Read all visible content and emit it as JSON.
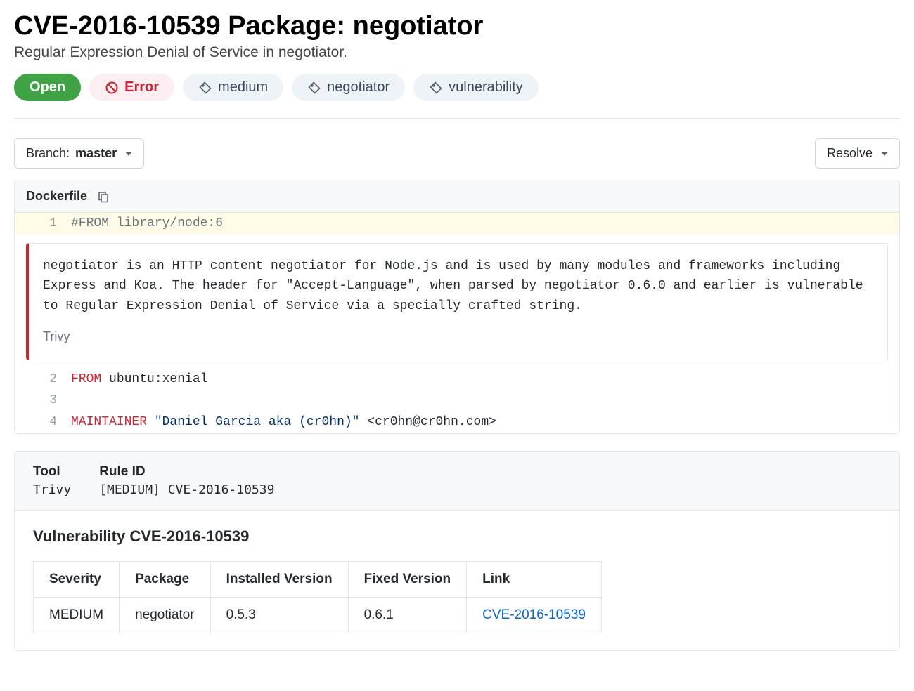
{
  "header": {
    "title": "CVE-2016-10539 Package: negotiator",
    "subtitle": "Regular Expression Denial of Service in negotiator."
  },
  "status": {
    "open_label": "Open",
    "error_label": "Error"
  },
  "tags": [
    "medium",
    "negotiator",
    "vulnerability"
  ],
  "toolbar": {
    "branch_label": "Branch:",
    "branch_value": "master",
    "resolve_label": "Resolve"
  },
  "code": {
    "filename": "Dockerfile",
    "line1_num": "1",
    "line1_text": "#FROM library/node:6",
    "callout_desc": "negotiator is an HTTP content negotiator for Node.js and is used by many modules and frameworks including Express and Koa. The header for \"Accept-Language\", when parsed by negotiator 0.6.0 and earlier is vulnerable to Regular Expression Denial of Service via a specially crafted string.",
    "callout_source": "Trivy",
    "line2_num": "2",
    "line2_kw": "FROM",
    "line2_rest": " ubuntu:xenial",
    "line3_num": "3",
    "line4_num": "4",
    "line4_kw": "MAINTAINER",
    "line4_str": " \"Daniel Garcia aka (cr0hn)\"",
    "line4_rest": " <cr0hn@cr0hn.com>"
  },
  "info": {
    "tool_label": "Tool",
    "tool_value": "Trivy",
    "rule_label": "Rule ID",
    "rule_value": "[MEDIUM] CVE-2016-10539",
    "vuln_heading": "Vulnerability CVE-2016-10539",
    "table": {
      "headers": [
        "Severity",
        "Package",
        "Installed Version",
        "Fixed Version",
        "Link"
      ],
      "row": {
        "severity": "MEDIUM",
        "package": "negotiator",
        "installed": "0.5.3",
        "fixed": "0.6.1",
        "link": "CVE-2016-10539"
      }
    }
  }
}
